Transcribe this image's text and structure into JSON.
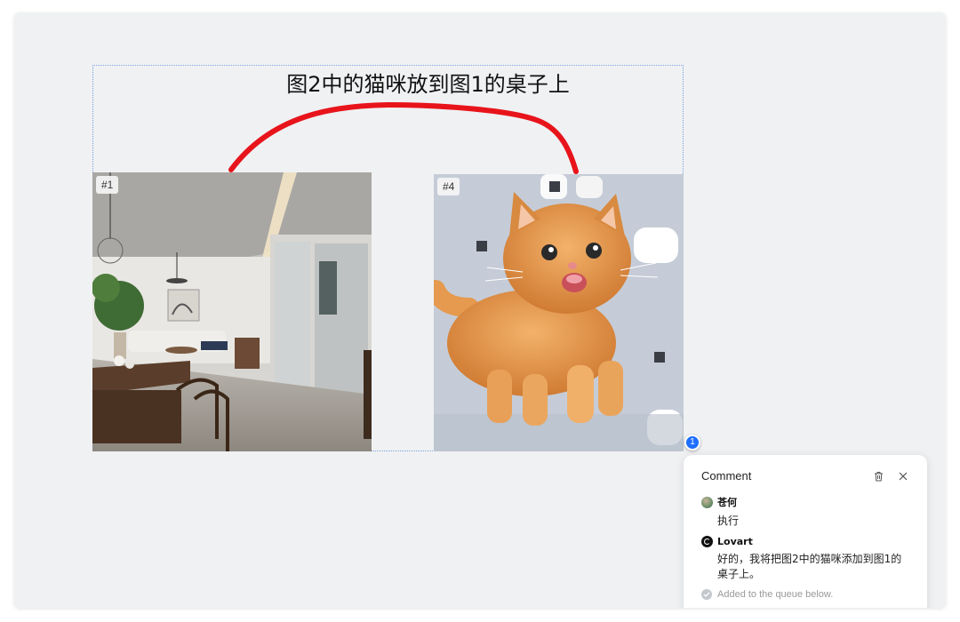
{
  "canvas": {
    "instruction_title": "图2中的猫咪放到图1的桌子上",
    "images": [
      {
        "tag": "#1",
        "subject": "interior-room"
      },
      {
        "tag": "#4",
        "subject": "orange-kitten"
      }
    ],
    "annotation_color": "#e8141b",
    "selection_color": "#7aa2e0"
  },
  "comment_pin": {
    "count": "1",
    "color": "#1f6fff"
  },
  "comment_panel": {
    "title": "Comment",
    "delete_icon": "trash-icon",
    "close_icon": "close-icon",
    "entries": [
      {
        "author": "苍何",
        "text": "执行"
      },
      {
        "author": "Lovart",
        "text": "好的，我将把图2中的猫咪添加到图1的桌子上。"
      }
    ],
    "status": "Added to the queue below."
  }
}
